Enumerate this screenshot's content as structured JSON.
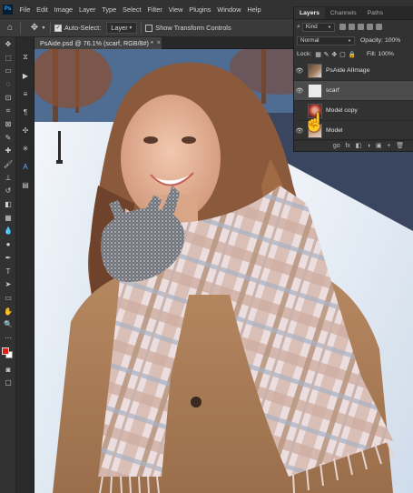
{
  "menubar": {
    "logo": "Ps",
    "items": [
      "File",
      "Edit",
      "Image",
      "Layer",
      "Type",
      "Select",
      "Filter",
      "View",
      "Plugins",
      "Window",
      "Help"
    ]
  },
  "options": {
    "auto_select_label": "Auto-Select:",
    "auto_select_target": "Layer",
    "transform_label": "Show Transform Controls"
  },
  "document": {
    "tab_title": "PsAide.psd @ 76.1% (scarf, RGB/8#) *",
    "tab_close": "×"
  },
  "colors": {
    "foreground": "#e31b10",
    "background": "#ffffff"
  },
  "layers_panel": {
    "tabs": [
      "Layers",
      "Channels",
      "Paths"
    ],
    "filter_kind": "Kind",
    "blend_mode": "Normal",
    "opacity_label": "Opacity:",
    "opacity_value": "100%",
    "lock_label": "Lock:",
    "fill_label": "Fill:",
    "fill_value": "100%",
    "layers": [
      {
        "name": "PsAide AIImage",
        "visible": true,
        "selected": false
      },
      {
        "name": "scarf",
        "visible": true,
        "selected": true
      },
      {
        "name": "Model copy",
        "visible": false,
        "selected": false
      },
      {
        "name": "Model",
        "visible": true,
        "selected": false
      }
    ],
    "footer": [
      "go",
      "fx",
      "◧",
      "◑",
      "▣",
      "+",
      "🗑"
    ]
  }
}
